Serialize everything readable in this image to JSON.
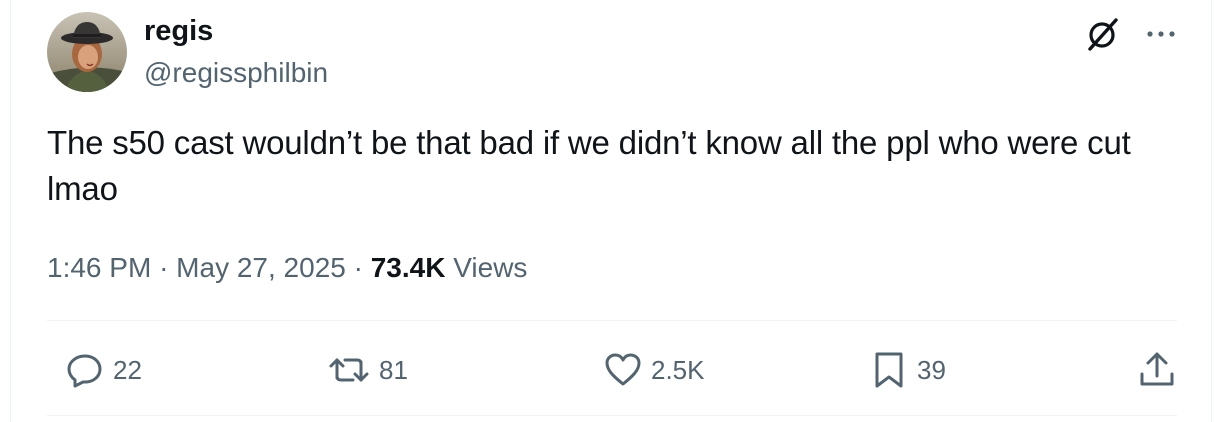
{
  "tweet": {
    "author": {
      "display_name": "regis",
      "handle": "@regissphilbin"
    },
    "text": "The s50 cast wouldn’t be that bad if we didn’t know all the ppl who were cut lmao",
    "time": "1:46 PM",
    "separator": "·",
    "date": "May 27, 2025",
    "views_count": "73.4K",
    "views_label": "Views"
  },
  "actions": {
    "replies": "22",
    "reposts": "81",
    "likes": "2.5K",
    "bookmarks": "39"
  },
  "icons": {
    "grok": "grok-icon",
    "more": "more-icon",
    "reply": "reply-icon",
    "repost": "repost-icon",
    "like": "heart-icon",
    "bookmark": "bookmark-icon",
    "share": "share-icon"
  },
  "colors": {
    "text_primary": "#0f1419",
    "text_secondary": "#536471",
    "divider": "#eff3f4"
  }
}
